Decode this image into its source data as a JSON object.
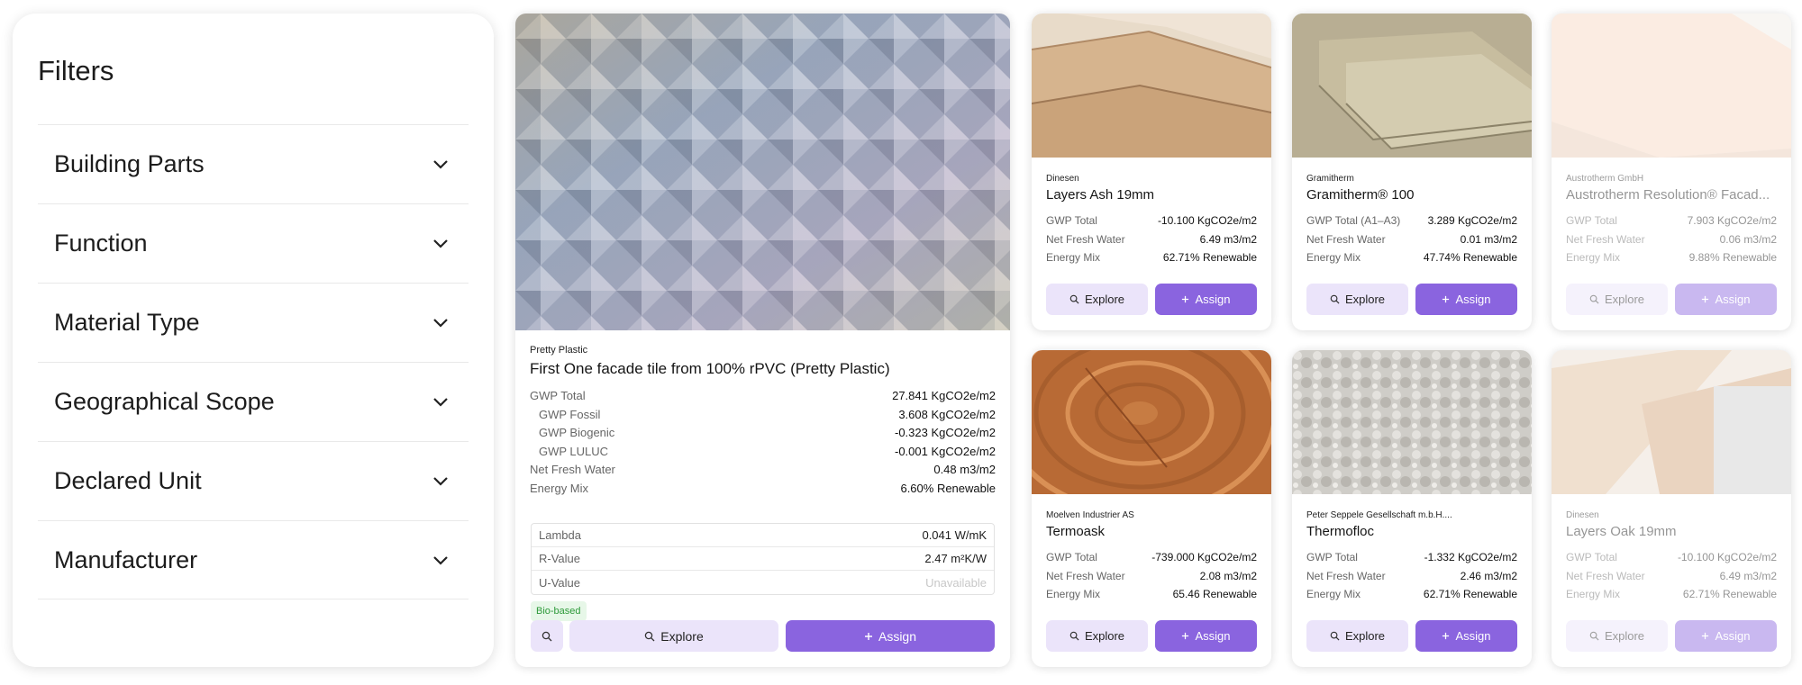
{
  "filters": {
    "title": "Filters",
    "items": [
      {
        "label": "Building Parts"
      },
      {
        "label": "Function"
      },
      {
        "label": "Material Type"
      },
      {
        "label": "Geographical Scope"
      },
      {
        "label": "Declared Unit"
      },
      {
        "label": "Manufacturer"
      }
    ]
  },
  "featured": {
    "manufacturer": "Pretty Plastic",
    "title": "First One facade tile from 100% rPVC (Pretty Plastic)",
    "rows": [
      {
        "k": "GWP Total",
        "v": "27.841 KgCO2e/m2",
        "sub": false
      },
      {
        "k": "GWP Fossil",
        "v": "3.608 KgCO2e/m2",
        "sub": true
      },
      {
        "k": "GWP Biogenic",
        "v": "-0.323 KgCO2e/m2",
        "sub": true
      },
      {
        "k": "GWP LULUC",
        "v": "-0.001 KgCO2e/m2",
        "sub": true
      },
      {
        "k": "Net Fresh Water",
        "v": "0.48 m3/m2",
        "sub": false
      },
      {
        "k": "Energy Mix",
        "v": "6.60% Renewable",
        "sub": false
      }
    ],
    "props": [
      {
        "k": "Lambda",
        "v": "0.041 W/mK"
      },
      {
        "k": "R-Value",
        "v": "2.47 m²K/W"
      },
      {
        "k": "U-Value",
        "v": "Unavailable"
      }
    ],
    "badge": "Bio-based",
    "explore": "Explore",
    "assign": "Assign"
  },
  "cards": [
    {
      "manufacturer": "Dinesen",
      "title": "Layers Ash 19mm",
      "rows": [
        {
          "k": "GWP Total",
          "v": "-10.100 KgCO2e/m2"
        },
        {
          "k": "Net Fresh Water",
          "v": "6.49 m3/m2"
        },
        {
          "k": "Energy Mix",
          "v": "62.71% Renewable"
        }
      ],
      "explore": "Explore",
      "assign": "Assign"
    },
    {
      "manufacturer": "Gramitherm",
      "title": "Gramitherm® 100",
      "rows": [
        {
          "k": "GWP Total (A1–A3)",
          "v": "3.289 KgCO2e/m2"
        },
        {
          "k": "Net Fresh Water",
          "v": "0.01 m3/m2"
        },
        {
          "k": "Energy Mix",
          "v": "47.74% Renewable"
        }
      ],
      "explore": "Explore",
      "assign": "Assign"
    },
    {
      "manufacturer": "Austrotherm GmbH",
      "title": "Austrotherm Resolution® Facad...",
      "rows": [
        {
          "k": "GWP Total",
          "v": "7.903 KgCO2e/m2"
        },
        {
          "k": "Net Fresh Water",
          "v": "0.06 m3/m2"
        },
        {
          "k": "Energy Mix",
          "v": "9.88% Renewable"
        }
      ],
      "explore": "Explore",
      "assign": "Assign"
    },
    {
      "manufacturer": "Moelven Industrier AS",
      "title": "Termoask",
      "rows": [
        {
          "k": "GWP Total",
          "v": "-739.000 KgCO2e/m2"
        },
        {
          "k": "Net Fresh Water",
          "v": "2.08 m3/m2"
        },
        {
          "k": "Energy Mix",
          "v": "65.46 Renewable"
        }
      ],
      "explore": "Explore",
      "assign": "Assign"
    },
    {
      "manufacturer": "Peter Seppele Gesellschaft m.b.H....",
      "title": "Thermofloc",
      "rows": [
        {
          "k": "GWP Total",
          "v": "-1.332 KgCO2e/m2"
        },
        {
          "k": "Net Fresh Water",
          "v": "2.46 m3/m2"
        },
        {
          "k": "Energy Mix",
          "v": "62.71% Renewable"
        }
      ],
      "explore": "Explore",
      "assign": "Assign"
    },
    {
      "manufacturer": "Dinesen",
      "title": "Layers Oak 19mm",
      "rows": [
        {
          "k": "GWP Total",
          "v": "-10.100 KgCO2e/m2"
        },
        {
          "k": "Net Fresh Water",
          "v": "6.49 m3/m2"
        },
        {
          "k": "Energy Mix",
          "v": "62.71% Renewable"
        }
      ],
      "explore": "Explore",
      "assign": "Assign"
    }
  ],
  "colors": {
    "accent": "#8a64df",
    "accent_light": "#ebe4fa",
    "badge_bg": "#e7f7e8",
    "badge_text": "#2e9a3a"
  },
  "icons": {
    "filter_chevron": "chevron-down-icon",
    "explore": "search-icon",
    "assign": "plus-icon"
  }
}
